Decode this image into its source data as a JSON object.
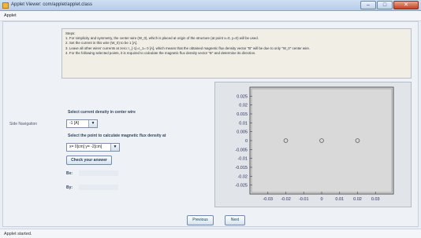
{
  "window": {
    "title": "Applet Viewer: com/applet/applet.class",
    "min_label": "–",
    "max_label": "□",
    "close_label": "✕"
  },
  "menu": {
    "applet_label": "Applet"
  },
  "side_nav": {
    "label": "Side Navigation"
  },
  "steps": {
    "lines": [
      "Steps:",
      "1. For simplicity and symmetry, the center wire (W_0), which is placed at origin of the structure (at point x=0, y=0) will be used.",
      "2. Set the current in this wire (W_0) to be 1 [A].",
      "3. Leave all other wires' currents at zero: I_{-1}=I_1= 0 [A], which means that the obtained magnetic flux density vector \"B\" will be due to only \"W_0\" center wire.",
      "4. For the following selected points, it is required to calculate the magnetic flux density vector \"B\" and determine its direction."
    ]
  },
  "controls": {
    "current_label": "Select current density in center wire",
    "current_value": "-1 [A]",
    "point_label": "Select the point to calculate magnetic flux density at",
    "point_value": "x= 0[cm] y= -2[cm]",
    "check_button": "Check your answer",
    "bx_label": "Bx:",
    "by_label": "By:"
  },
  "navigation": {
    "previous": "Previous",
    "next": "Next"
  },
  "status": {
    "text": "Applet started."
  },
  "chart_data": {
    "type": "scatter",
    "title": "",
    "xlabel": "",
    "ylabel": "",
    "xlim": [
      -0.04,
      0.04
    ],
    "ylim": [
      -0.03,
      0.03
    ],
    "x_ticks": [
      "-0.03",
      "-0.02",
      "-0.01",
      "0",
      "0.01",
      "0.02",
      "0.03"
    ],
    "y_ticks": [
      "0.025",
      "0.02",
      "0.015",
      "0.01",
      "0.005",
      "0",
      "-0.005",
      "-0.01",
      "-0.015",
      "-0.02",
      "-0.025"
    ],
    "x_tick_values": [
      -0.03,
      -0.02,
      -0.01,
      0,
      0.01,
      0.02,
      0.03
    ],
    "y_tick_values": [
      0.025,
      0.02,
      0.015,
      0.01,
      0.005,
      0,
      -0.005,
      -0.01,
      -0.015,
      -0.02,
      -0.025
    ],
    "series": [
      {
        "x": [
          -0.02,
          0,
          0.02
        ],
        "y": [
          0,
          0,
          0
        ]
      }
    ],
    "grid": false,
    "marker": "open-circle"
  }
}
